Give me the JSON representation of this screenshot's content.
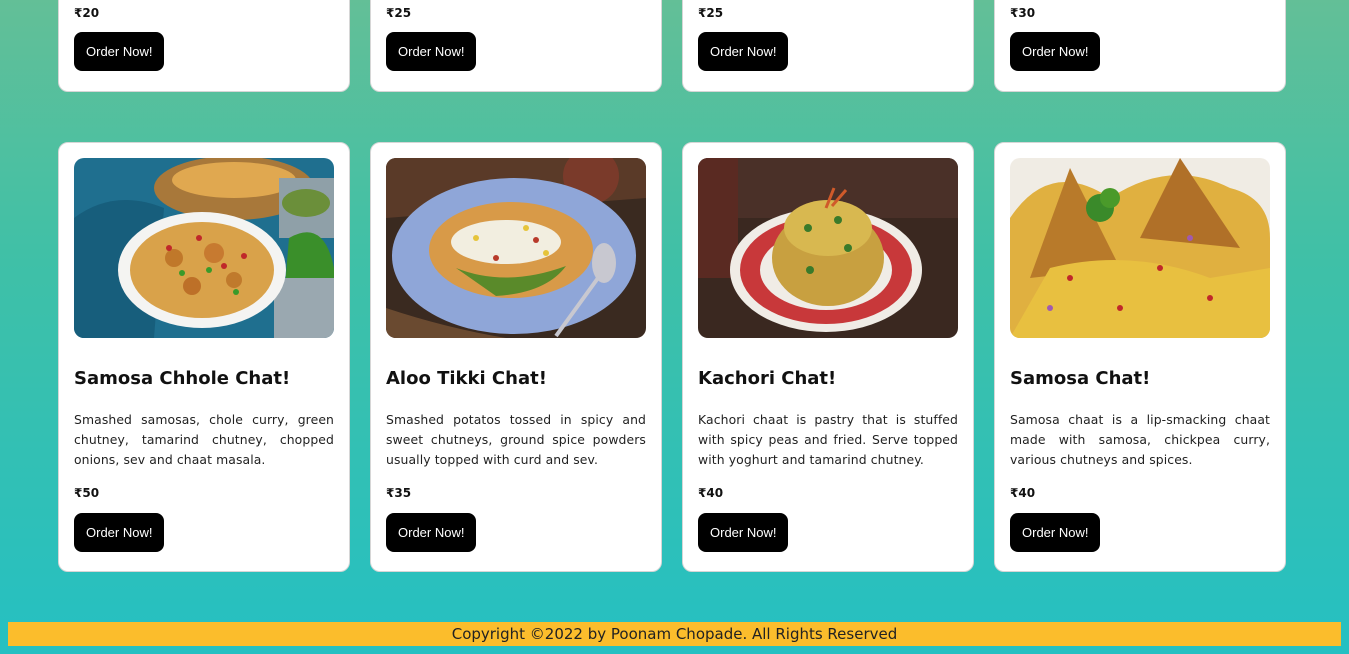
{
  "top_row": [
    {
      "price": "₹20",
      "button": "Order Now!"
    },
    {
      "price": "₹25",
      "button": "Order Now!"
    },
    {
      "price": "₹25",
      "button": "Order Now!"
    },
    {
      "price": "₹30",
      "button": "Order Now!"
    }
  ],
  "cards": [
    {
      "title": "Samosa Chhole Chat!",
      "description": "Smashed samosas, chole curry, green chutney, tamarind chutney, chopped onions, sev and chaat masala.",
      "price": "₹50",
      "button": "Order Now!"
    },
    {
      "title": "Aloo Tikki Chat!",
      "description": "Smashed potatos tossed in spicy and sweet chutneys, ground spice powders usually topped with curd and sev.",
      "price": "₹35",
      "button": "Order Now!"
    },
    {
      "title": "Kachori Chat!",
      "description": "Kachori chaat is pastry that is stuffed with spicy peas and fried. Serve topped with yoghurt and tamarind chutney.",
      "price": "₹40",
      "button": "Order Now!"
    },
    {
      "title": "Samosa Chat!",
      "description": "Samosa chaat is a lip-smacking chaat made with samosa, chickpea curry, various chutneys and spices.",
      "price": "₹40",
      "button": "Order Now!"
    }
  ],
  "footer": {
    "text": "Copyright ©2022 by Poonam Chopade. All Rights Reserved"
  },
  "colors": {
    "footer_bg": "#fbbd2c",
    "button_bg": "#000000",
    "page_gradient_top": "#63bf97",
    "page_gradient_bottom": "#25c0c2"
  }
}
